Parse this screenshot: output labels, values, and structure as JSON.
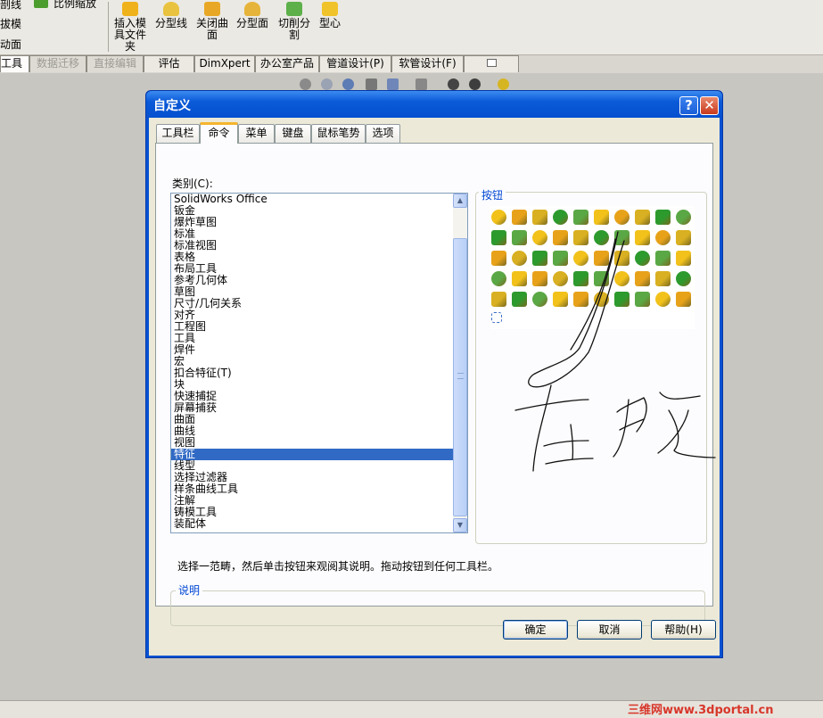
{
  "ribbon": {
    "left_items": [
      "剖线",
      "拔模",
      "动面"
    ],
    "scale": "比例缩放",
    "buttons": [
      {
        "label": "插入模\n具文件\n夹",
        "icon": "insert-mold-folder-icon"
      },
      {
        "label": "分型线",
        "icon": "parting-line-icon"
      },
      {
        "label": "关闭曲\n面",
        "icon": "shut-off-surface-icon"
      },
      {
        "label": "分型面",
        "icon": "parting-surface-icon"
      },
      {
        "label": "切削分\n割",
        "icon": "tooling-split-icon"
      },
      {
        "label": "型心",
        "icon": "core-icon"
      }
    ]
  },
  "cmd_tabs": [
    "工具",
    "数据迁移",
    "直接编辑",
    "评估",
    "DimXpert",
    "办公室产品",
    "管道设计(P)",
    "软管设计(F)"
  ],
  "dialog": {
    "title": "自定义",
    "help_glyph": "?",
    "close_glyph": "✕",
    "tabs": [
      "工具栏",
      "命令",
      "菜单",
      "键盘",
      "鼠标笔势",
      "选项"
    ],
    "category_label": "类别(C):",
    "categories": [
      "SolidWorks Office",
      "钣金",
      "爆炸草图",
      "标准",
      "标准视图",
      "表格",
      "布局工具",
      "参考几何体",
      "草图",
      "尺寸/几何关系",
      "对齐",
      "工程图",
      "工具",
      "焊件",
      "宏",
      "扣合特征(T)",
      "块",
      "快速捕捉",
      "屏幕捕获",
      "曲面",
      "曲线",
      "视图",
      "特征",
      "线型",
      "选择过滤器",
      "样条曲线工具",
      "注解",
      "铸模工具",
      "装配体"
    ],
    "selected_category": "特征",
    "buttons_label": "按钮",
    "hint": "选择一范畴，然后单击按钮来观阅其说明。拖动按钮到任何工具栏。",
    "description_label": "说明",
    "ok": "确定",
    "cancel": "取消",
    "help": "帮助(H)"
  },
  "watermark": "三维网www.3dportal.cn",
  "colors": {
    "title_blue": "#0852d2",
    "selection": "#316ac5",
    "icon_yellow": "#f2c21b",
    "icon_green": "#2d9a2d",
    "watermark_red": "#d8362a"
  }
}
